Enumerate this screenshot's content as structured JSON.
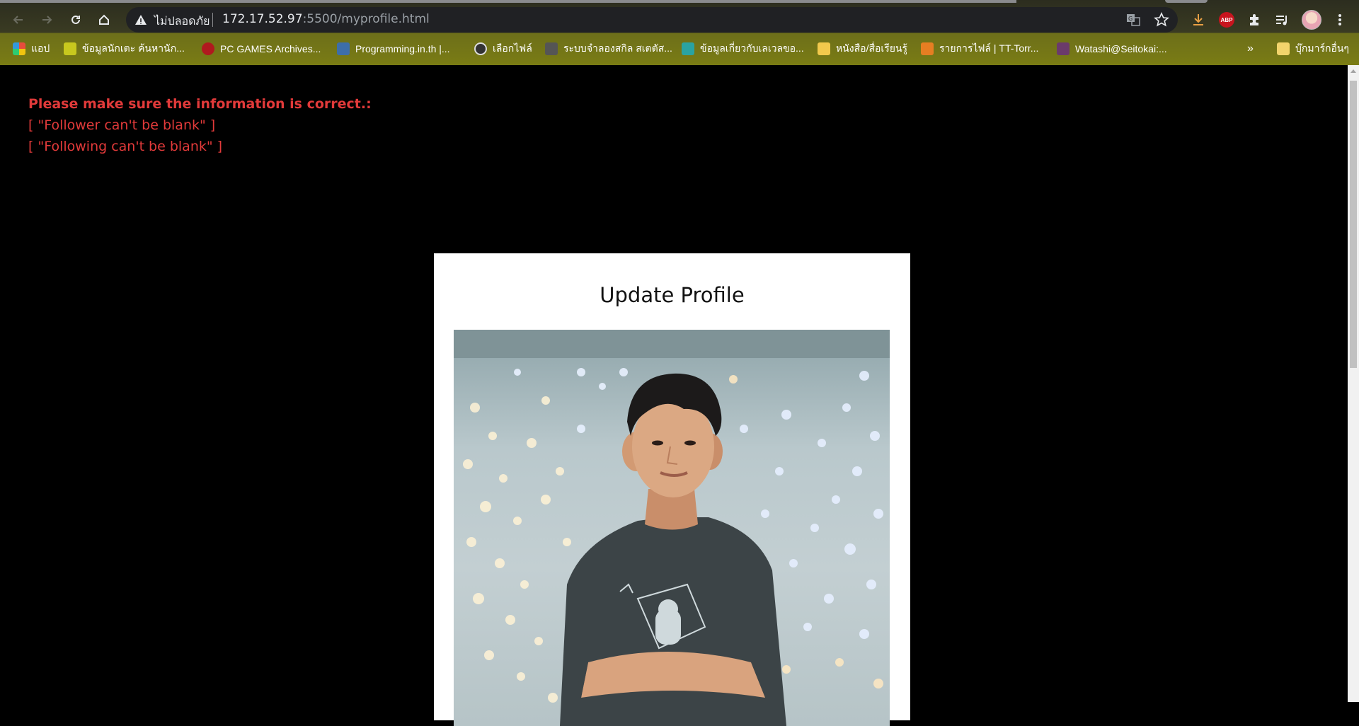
{
  "browser": {
    "security_label": "ไม่ปลอดภัย",
    "url_host": "172.17.52.97",
    "url_rest": ":5500/myprofile.html",
    "bookmarks": [
      {
        "label": "แอป",
        "color": "#e74c3c"
      },
      {
        "label": "ข้อมูลนักเตะ ค้นหานัก...",
        "color": "#c8c81e"
      },
      {
        "label": "PC GAMES Archives...",
        "color": "#b0191e"
      },
      {
        "label": "Programming.in.th |...",
        "color": "#3d6ea8"
      },
      {
        "label": "เลือกไฟล์",
        "color": "#333333"
      },
      {
        "label": "ระบบจำลองสกิล สเตตัส...",
        "color": "#555555"
      },
      {
        "label": "ข้อมูลเกี่ยวกับเลเวลขอ...",
        "color": "#2aa3a1"
      },
      {
        "label": "หนังสือ/สื่อเรียนรู้",
        "color": "#f2c94c"
      },
      {
        "label": "รายการไฟล์ | TT-Torr...",
        "color": "#e67e22"
      },
      {
        "label": "Watashi@Seitokai:...",
        "color": "#6b3a6b"
      }
    ],
    "bookmarks_overflow": "»",
    "other_bookmarks": "บุ๊กมาร์กอื่นๆ"
  },
  "errors": {
    "title": "Please make sure the information is correct.:",
    "messages": [
      "[ \"Follower can't be blank\" ]",
      "[ \"Following can't be blank\" ]"
    ]
  },
  "profile_card": {
    "title": "Update Profile"
  },
  "colors": {
    "error": "#e23a3a",
    "page_background": "#000000",
    "card_background": "#ffffff"
  }
}
